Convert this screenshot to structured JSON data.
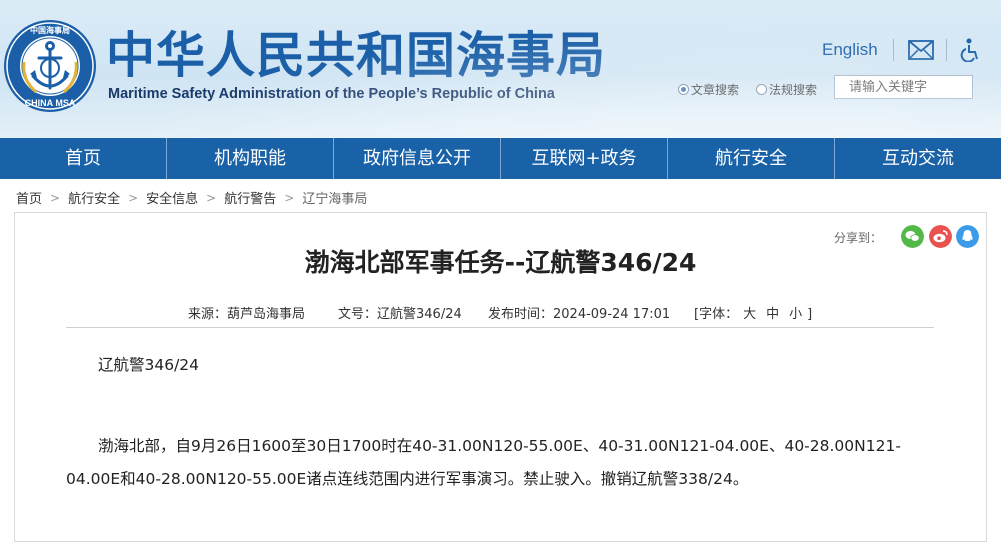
{
  "header": {
    "logo_text_top": "中国海事局",
    "logo_text_bottom": "CHINA MSA",
    "title_cn": "中华人民共和国海事局",
    "title_en": "Maritime Safety Administration of the People’s Republic of China",
    "english_link": "English",
    "search_options": [
      "文章搜索",
      "法规搜索"
    ],
    "search_selected": "文章搜索",
    "search_placeholder": "请输入关键字"
  },
  "nav": {
    "items": [
      "首页",
      "机构职能",
      "政府信息公开",
      "互联网+政务",
      "航行安全",
      "互动交流"
    ]
  },
  "breadcrumb": [
    "首页",
    "航行安全",
    "安全信息",
    "航行警告",
    "辽宁海事局"
  ],
  "share": {
    "label": "分享到：",
    "icons": [
      "wechat-icon",
      "weibo-icon",
      "qq-icon"
    ]
  },
  "article": {
    "title": "渤海北部军事任务--辽航警346/24",
    "source": "来源：葫芦岛海事局",
    "doc_no": "文号：辽航警346/24",
    "published": "发布时间：2024-09-24 17:01",
    "font_label": "[字体：",
    "font_sizes": [
      "大",
      "中",
      "小"
    ],
    "font_close": "]",
    "paragraphs": [
      "辽航警346/24",
      "渤海北部，自9月26日1600至30日1700时在40-31.00N120-55.00E、40-31.00N121-04.00E、40-28.00N121-04.00E和40-28.00N120-55.00E诸点连线范围内进行军事演习。禁止驶入。撤销辽航警338/24。"
    ]
  },
  "colors": {
    "brand_blue": "#1a62a8",
    "title_blue": "#1a5fa8",
    "wechat": "#52b848",
    "weibo": "#e8524f",
    "qq": "#3c9be8"
  }
}
